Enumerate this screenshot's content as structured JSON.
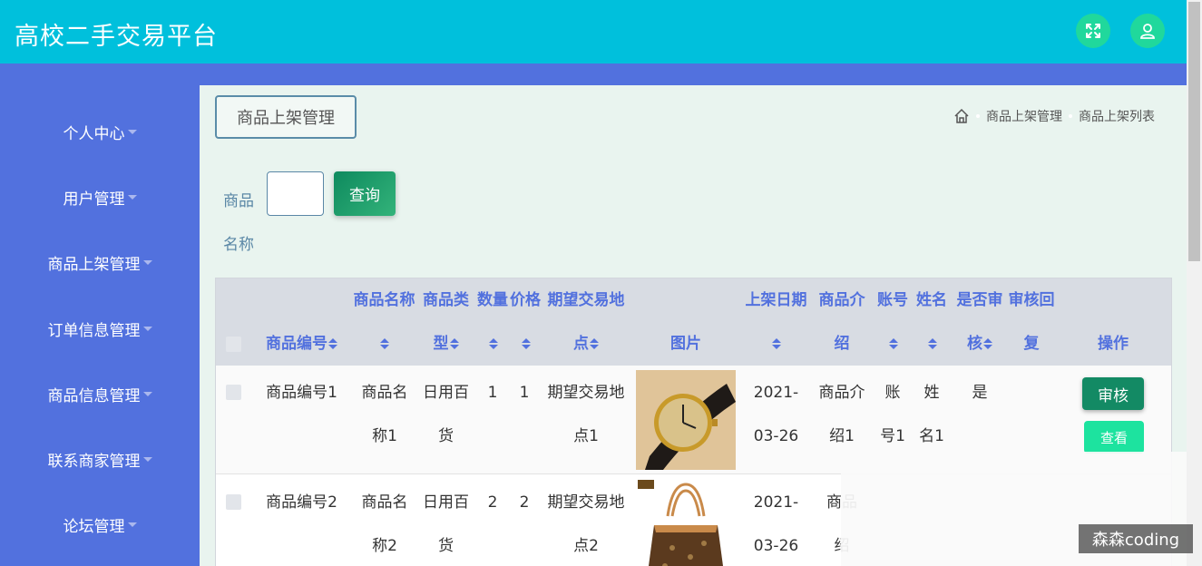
{
  "app": {
    "title": "高校二手交易平台"
  },
  "header_icons": {
    "fullscreen": "expand-icon",
    "user": "user-icon"
  },
  "sidebar": {
    "items": [
      {
        "label": "个人中心"
      },
      {
        "label": "用户管理"
      },
      {
        "label": "商品上架管理"
      },
      {
        "label": "订单信息管理"
      },
      {
        "label": "商品信息管理"
      },
      {
        "label": "联系商家管理"
      },
      {
        "label": "论坛管理"
      }
    ]
  },
  "page": {
    "tag": "商品上架管理",
    "breadcrumb": [
      "商品上架管理",
      "商品上架列表"
    ]
  },
  "search": {
    "label_line1": "商品",
    "label_line2": "名称",
    "value": "",
    "button": "查询"
  },
  "table": {
    "headers": {
      "code": "商品编号",
      "name_1": "商品名称",
      "type_1": "商品类",
      "type_2": "型",
      "qty": "数量",
      "price": "价格",
      "place_1": "期望交易地",
      "place_2": "点",
      "image": "图片",
      "date": "上架日期",
      "intro_1": "商品介",
      "intro_2": "绍",
      "account": "账号",
      "realname": "姓名",
      "audit_1": "是否审",
      "audit_2": "核",
      "reply_1": "审核回",
      "reply_2": "复",
      "actions": "操作"
    },
    "rows": [
      {
        "code": "商品编号1",
        "name_1": "商品名",
        "name_2": "称1",
        "type_1": "日用百",
        "type_2": "货",
        "qty": "1",
        "price": "1",
        "place_1": "期望交易地",
        "place_2": "点1",
        "image": "watch",
        "date_1": "2021-",
        "date_2": "03-26",
        "intro_1": "商品介",
        "intro_2": "绍1",
        "account_1": "账",
        "account_2": "号1",
        "realname_1": "姓",
        "realname_2": "名1",
        "audit": "是",
        "review_btn": "审核",
        "view_btn": "查看"
      },
      {
        "code": "商品编号2",
        "name_1": "商品名",
        "name_2": "称2",
        "type_1": "日用百",
        "type_2": "货",
        "qty": "2",
        "price": "2",
        "place_1": "期望交易地",
        "place_2": "点2",
        "image": "handbag",
        "date_1": "2021-",
        "date_2": "03-26",
        "intro_1": "商品",
        "intro_2": "绍"
      }
    ]
  },
  "watermark": "森森coding",
  "colors": {
    "topbar": "#00c0dc",
    "sidebar": "#5271de",
    "main_bg": "#e9f4ef",
    "accent_green": "#138a64"
  }
}
